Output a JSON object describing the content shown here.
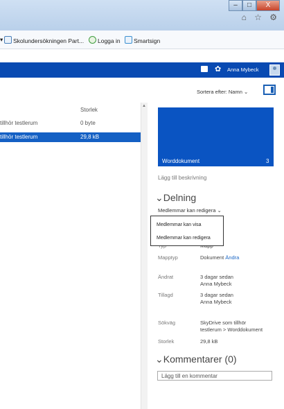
{
  "window": {
    "min": "–",
    "max": "□",
    "close": "X",
    "toolbar_icons": "⌂ ☆ ⚙"
  },
  "favorites": [
    {
      "label": "▾"
    },
    {
      "label": "Skolundersökningen Part..."
    },
    {
      "label": "Logga in"
    },
    {
      "label": "Smartsign"
    }
  ],
  "appbar": {
    "user_name": "Anna Mybeck"
  },
  "toolbar": {
    "sort_label": "Sortera efter: Namn ⌄"
  },
  "list": {
    "columns": {
      "size": "Storlek"
    },
    "rows": [
      {
        "name": "tillhör testlerum",
        "size": "0 byte"
      },
      {
        "name": "tillhör testlerum",
        "size": "29,8 kB"
      }
    ]
  },
  "scrollbar": {
    "up_arrow": "▲"
  },
  "details": {
    "tile_name": "Worddokument",
    "tile_count": "3",
    "add_description": "Lägg till beskrivning",
    "sharing_heading": "⌄Delning",
    "permission_select": "Medlemmar kan redigera ⌄",
    "dropdown_options": [
      "Medlemmar kan visa",
      "Medlemmar kan redigera"
    ],
    "typ_label": "Typ",
    "typ_value": "Mapp",
    "mapptyp_label": "Mapptyp",
    "mapptyp_value": "Dokument",
    "mapptyp_link": "Ändra",
    "andrat_label": "Ändrat",
    "andrat_value1": "3 dagar sedan",
    "andrat_value2": "Anna Mybeck",
    "tillagd_label": "Tillagd",
    "tillagd_value1": "3 dagar sedan",
    "tillagd_value2": "Anna Mybeck",
    "sokvag_label": "Sökväg",
    "sokvag_value1": "SkyDrive som tillhör",
    "sokvag_value2": "testlerum  > Worddokument",
    "storlek_label": "Storlek",
    "storlek_value": "29,8 kB",
    "comments_heading": "⌄Kommentarer (0)",
    "comment_placeholder": "Lägg till en kommentar"
  }
}
